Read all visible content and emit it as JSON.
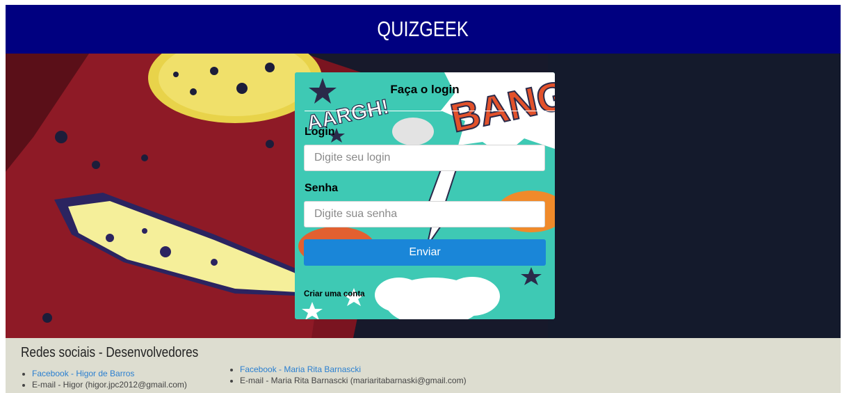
{
  "header": {
    "title": "QUIZGEEK"
  },
  "login": {
    "title": "Faça o login",
    "login_label": "Login",
    "login_placeholder": "Digite seu login",
    "password_label": "Senha",
    "password_placeholder": "Digite sua senha",
    "submit_label": "Enviar",
    "create_account": "Criar uma conta"
  },
  "comic_text": {
    "aargh": "AARGH!",
    "bang": "BANG"
  },
  "footer": {
    "title": "Redes sociais - Desenvolvedores",
    "dev1": {
      "facebook": "Facebook - Higor de Barros",
      "email": "E-mail - Higor (higor.jpc2012@gmail.com)"
    },
    "dev2": {
      "facebook": "Facebook - Maria Rita Barnascki",
      "email": "E-mail - Maria Rita Barnascki (mariaritabarnaski@gmail.com)"
    }
  },
  "colors": {
    "header_bg": "#000080",
    "button_bg": "#1a86d8",
    "card_bg": "#3ec9b4",
    "footer_bg": "#ddddd0"
  }
}
